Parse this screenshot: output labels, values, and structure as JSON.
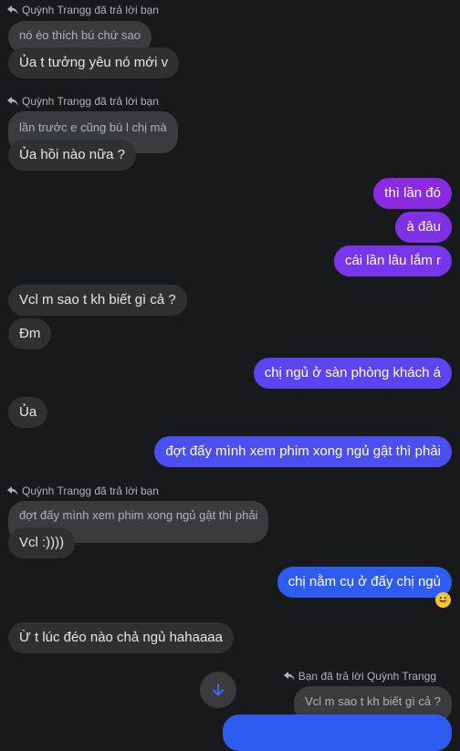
{
  "colors": {
    "background": "#18191a",
    "incoming_bubble": "#303030",
    "quoted_bubble": "#3a3b3c",
    "outgoing_purple": "#8a2be2",
    "outgoing_violet": "#6a3df0",
    "outgoing_blue": "#2f5cf0"
  },
  "messages": {
    "reply1_header": "Quỳnh Trangg đã trả lời bạn",
    "reply1_quoted": "nó éo thích bú chứ sao",
    "reply1_text": "Ủa t tưởng yêu nó mới v",
    "reply2_header": "Quỳnh Trangg đã trả lời bạn",
    "reply2_quoted": "lần trước e cũng bú l chị mà",
    "reply2_text": "Ủa hồi nào nữa ?",
    "out1": "thì lần đó",
    "out2": "à đâu",
    "out3": "cái lần lâu lắm r",
    "in1": "Vcl m sao t kh biết gì cả ?",
    "in2": "Đm",
    "out4": "chị ngủ ở sàn phòng khách á",
    "in3": "Ủa",
    "out5": "đợt đấy mình xem phim xong ngủ gật thì phải",
    "reply3_header": "Quỳnh Trangg đã trả lời bạn",
    "reply3_quoted": "đợt đấy mình xem phim xong ngủ gật thì phải",
    "reply3_text": "Vcl :))))",
    "out6": "chị nằm cụ ở đấy chị ngủ",
    "out6_reaction": "😆",
    "in4": "Ừ t lúc đéo nào chả ngủ hahaaaa",
    "reply4_header": "Bạn đã trả lời Quỳnh Trangg",
    "reply4_quoted": "Vcl m sao t kh biết gì cả ?"
  },
  "icons": {
    "reply": "reply-arrow-icon",
    "scroll_down": "arrow-down-icon",
    "reaction": "laughing-emoji-icon"
  }
}
